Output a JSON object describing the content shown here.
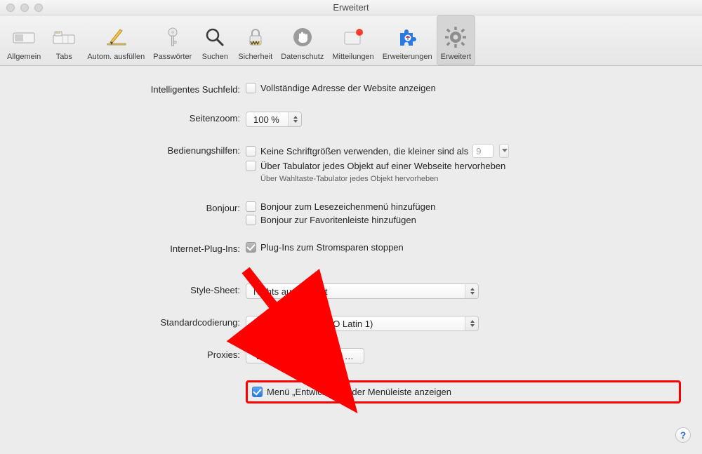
{
  "window": {
    "title": "Erweitert"
  },
  "toolbar": [
    {
      "id": "general",
      "label": "Allgemein"
    },
    {
      "id": "tabs",
      "label": "Tabs"
    },
    {
      "id": "autofill",
      "label": "Autom. ausfüllen"
    },
    {
      "id": "passwords",
      "label": "Passwörter"
    },
    {
      "id": "search",
      "label": "Suchen"
    },
    {
      "id": "security",
      "label": "Sicherheit"
    },
    {
      "id": "privacy",
      "label": "Datenschutz"
    },
    {
      "id": "notifications",
      "label": "Mitteilungen"
    },
    {
      "id": "extensions",
      "label": "Erweiterungen"
    },
    {
      "id": "advanced",
      "label": "Erweitert",
      "selected": true
    }
  ],
  "smartsearch": {
    "label": "Intelligentes Suchfeld:",
    "full_url_label": "Vollständige Adresse der Website anzeigen"
  },
  "zoom": {
    "label": "Seitenzoom:",
    "value": "100 %"
  },
  "accessibility": {
    "label": "Bedienungshilfen:",
    "min_font_label": "Keine Schriftgrößen verwenden, die kleiner sind als",
    "min_font_value": "9",
    "tab_highlight_label": "Über Tabulator jedes Objekt auf einer Webseite hervorheben",
    "tab_highlight_hint": "Über Wahltaste-Tabulator jedes Objekt hervorheben"
  },
  "bonjour": {
    "label": "Bonjour:",
    "bookmarks_label": "Bonjour zum Lesezeichenmenü hinzufügen",
    "favorites_label": "Bonjour zur Favoritenleiste hinzufügen"
  },
  "plugins": {
    "label": "Internet-Plug-Ins:",
    "powersave_label": "Plug-Ins zum Stromsparen stoppen"
  },
  "stylesheet": {
    "label": "Style-Sheet:",
    "value": "Nichts ausgewählt"
  },
  "encoding": {
    "label": "Standardcodierung:",
    "value": "Westeuropäisch (ISO Latin 1)"
  },
  "proxies": {
    "label": "Proxies:",
    "button": "Einstellungen ändern …"
  },
  "developer": {
    "label": "Menü „Entwickler“ in der Menüleiste anzeigen"
  },
  "help_glyph": "?"
}
